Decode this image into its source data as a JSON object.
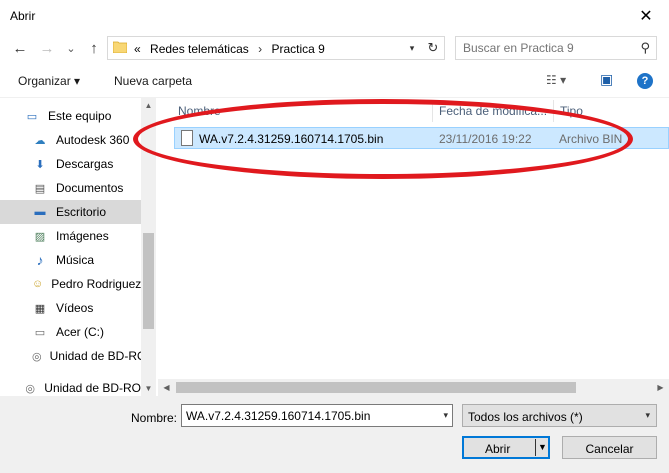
{
  "window": {
    "title": "Abrir",
    "close_glyph": "✕"
  },
  "nav": {
    "back_glyph": "←",
    "forward_glyph": "→",
    "recent_glyph": "⌄",
    "up_glyph": "↑",
    "breadcrumb_prefix": "«",
    "breadcrumbs": [
      "Redes telemáticas",
      "Practica 9"
    ],
    "separator": "›",
    "search_placeholder": "Buscar en Practica 9"
  },
  "toolbar": {
    "organize_label": "Organizar ▾",
    "new_folder_label": "Nueva carpeta",
    "view_glyph": "☷ ▾",
    "pane_glyph": "▣",
    "help_glyph": "?"
  },
  "sidebar": {
    "items": [
      {
        "label": "Este equipo",
        "icon": "computer-icon",
        "glyph": "▭"
      },
      {
        "label": "Autodesk 360",
        "icon": "cloud-icon",
        "glyph": "☁"
      },
      {
        "label": "Descargas",
        "icon": "download-icon",
        "glyph": "⬇"
      },
      {
        "label": "Documentos",
        "icon": "document-icon",
        "glyph": "▤"
      },
      {
        "label": "Escritorio",
        "icon": "desktop-icon",
        "glyph": "▬"
      },
      {
        "label": "Imágenes",
        "icon": "image-icon",
        "glyph": "▨"
      },
      {
        "label": "Música",
        "icon": "music-icon",
        "glyph": "♪"
      },
      {
        "label": "Pedro Rodriguez",
        "icon": "user-icon",
        "glyph": "☺"
      },
      {
        "label": "Vídeos",
        "icon": "video-icon",
        "glyph": "▦"
      },
      {
        "label": "Acer (C:)",
        "icon": "drive-icon",
        "glyph": "▭"
      },
      {
        "label": "Unidad de BD-RO",
        "icon": "disc-drive-icon",
        "glyph": "◎"
      },
      {
        "label": "Unidad de BD-RO",
        "icon": "disc-drive-icon",
        "glyph": "◎"
      }
    ]
  },
  "files": {
    "columns": [
      "Nombre",
      "Fecha de modifica...",
      "Tipo"
    ],
    "rows": [
      {
        "name": "WA.v7.2.4.31259.160714.1705.bin",
        "date": "23/11/2016 19:22",
        "type": "Archivo BIN"
      }
    ]
  },
  "footer": {
    "filename_label": "Nombre:",
    "filename_value": "WA.v7.2.4.31259.160714.1705.bin",
    "filter_value": "Todos los archivos (*)",
    "open_label": "Abrir",
    "cancel_label": "Cancelar"
  },
  "colors": {
    "selection": "#cce8ff",
    "annotation": "#e0191e",
    "accent": "#0078d7"
  }
}
